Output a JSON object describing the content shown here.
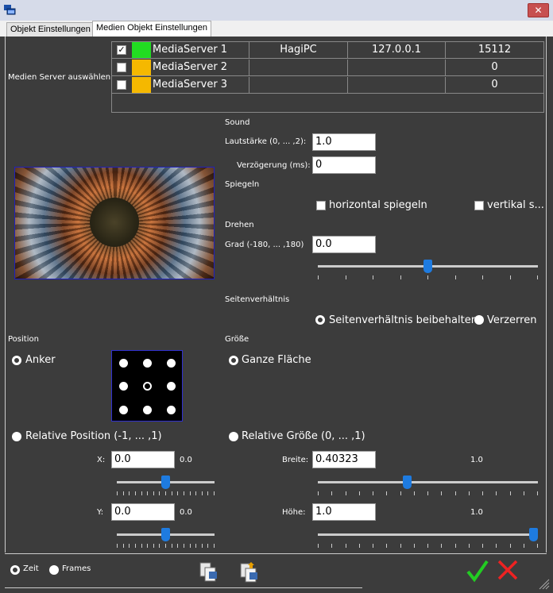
{
  "tabs": [
    "Objekt Einstellungen",
    "Medien Objekt Einstellungen"
  ],
  "server": {
    "section_label": "Medien Server auswählen",
    "rows": [
      {
        "checked": true,
        "color": "#22dd22",
        "name": "MediaServer 1",
        "host": "HagiPC",
        "ip": "127.0.0.1",
        "port": "15112"
      },
      {
        "checked": false,
        "color": "#f5b800",
        "name": "MediaServer 2",
        "host": "",
        "ip": "",
        "port": "0"
      },
      {
        "checked": false,
        "color": "#f5b800",
        "name": "MediaServer 3",
        "host": "",
        "ip": "",
        "port": "0"
      }
    ]
  },
  "sound": {
    "header": "Sound",
    "volume_label": "Lautstärke (0, ... ,2):",
    "volume_value": "1.0",
    "delay_label": "Verzögerung (ms):",
    "delay_value": "0"
  },
  "mirror": {
    "header": "Spiegeln",
    "horizontal_label": "horizontal spiegeln",
    "vertical_label": "vertikal s..."
  },
  "rotate": {
    "header": "Drehen",
    "degree_label": "Grad  (-180, ... ,180)",
    "degree_value": "0.0",
    "slider_fraction": 0.5
  },
  "aspect": {
    "header": "Seitenverhältnis",
    "keep_label": "Seitenverhältnis beibehalten",
    "distort_label": "Verzerren",
    "selected": "keep"
  },
  "position": {
    "header": "Position",
    "anchor_label": "Anker",
    "relative_label": "Relative Position (-1, ... ,1)",
    "selected": "relative",
    "x_label": "X:",
    "x_value": "0.0",
    "x_readout": "0.0",
    "x_slider_fraction": 0.5,
    "y_label": "Y:",
    "y_value": "0.0",
    "y_readout": "0.0",
    "y_slider_fraction": 0.5
  },
  "size": {
    "header": "Größe",
    "full_label": "Ganze Fläche",
    "relative_label": "Relative Größe (0, ... ,1)",
    "selected": "relative",
    "width_label": "Breite:",
    "width_value": "0.40323",
    "width_readout": "1.0",
    "width_slider_fraction": 0.40323,
    "height_label": "Höhe:",
    "height_value": "1.0",
    "height_readout": "1.0",
    "height_slider_fraction": 1.0
  },
  "footer": {
    "time_label": "Zeit",
    "frames_label": "Frames",
    "selected": "time"
  },
  "icons": {
    "app": "app-window-icon",
    "close": "close-icon",
    "ok": "checkmark-icon",
    "cancel": "cross-icon"
  },
  "colors": {
    "ok": "#22cc22",
    "cancel": "#ee2222",
    "slider": "#1e7be0"
  }
}
